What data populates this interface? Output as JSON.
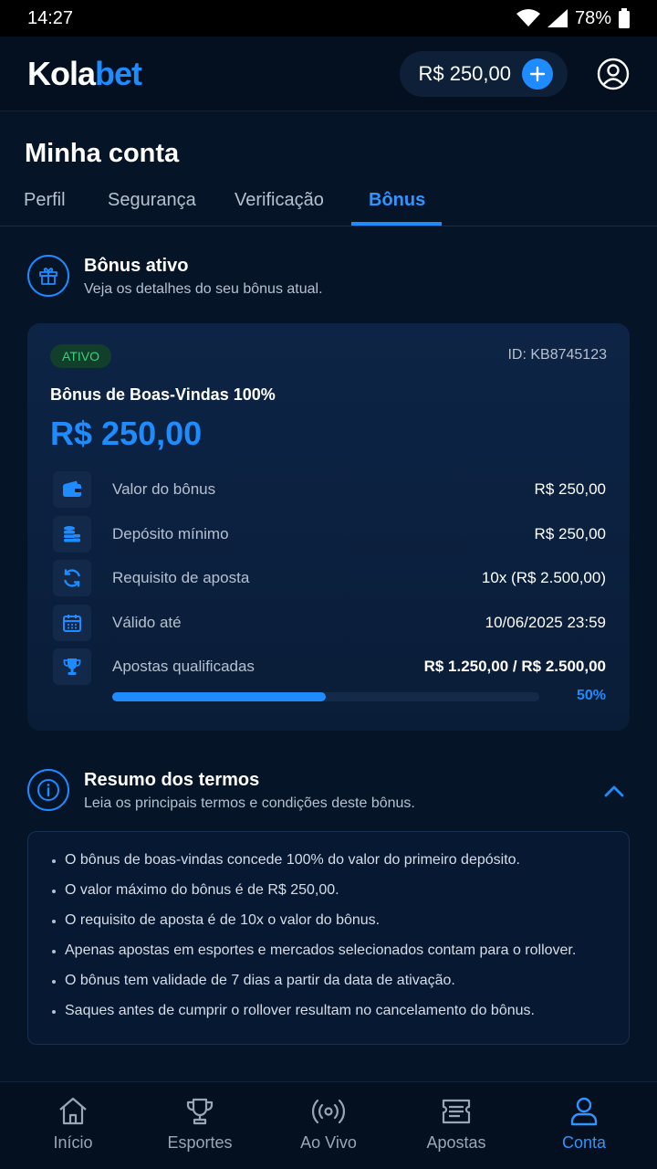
{
  "status": {
    "time": "14:27",
    "battery": "78%"
  },
  "header": {
    "logo_a": "Kola",
    "logo_b": "bet",
    "balance": "R$ 250,00"
  },
  "page": {
    "title": "Minha conta"
  },
  "tabs": [
    {
      "label": "Perfil"
    },
    {
      "label": "Segurança"
    },
    {
      "label": "Verificação"
    },
    {
      "label": "Bônus",
      "active": true
    }
  ],
  "active_bonus": {
    "title": "Bônus ativo",
    "subtitle": "Veja os detalhes do seu bônus atual.",
    "status": "ATIVO",
    "id": "ID: KB8745123",
    "name": "Bônus de Boas-Vindas 100%",
    "amount": "R$ 250,00",
    "rows": [
      {
        "icon": "wallet-icon",
        "label": "Valor do bônus",
        "value": "R$ 250,00"
      },
      {
        "icon": "coins-icon",
        "label": "Depósito mínimo",
        "value": "R$ 250,00"
      },
      {
        "icon": "refresh-icon",
        "label": "Requisito de aposta",
        "value": "10x (R$ 2.500,00)"
      },
      {
        "icon": "calendar-icon",
        "label": "Válido até",
        "value": "10/06/2025 23:59"
      },
      {
        "icon": "trophy-icon",
        "label": "Apostas qualificadas",
        "value": "R$ 1.250,00 / R$ 2.500,00"
      }
    ],
    "progress": 0.5,
    "progress_label": "50%"
  },
  "terms": {
    "title": "Resumo dos termos",
    "subtitle": "Leia os principais termos e condições deste bônus.",
    "items": [
      "O bônus de boas-vindas concede 100% do valor do primeiro depósito.",
      "O valor máximo do bônus é de R$ 250,00.",
      "O requisito de aposta é de 10x o valor do bônus.",
      "Apenas apostas em esportes e mercados selecionados contam para o rollover.",
      "O bônus tem validade de 7 dias a partir da data de ativação.",
      "Saques antes de cumprir o rollover resultam no cancelamento do bônus."
    ]
  },
  "nav": [
    {
      "label": "Início",
      "icon": "home-icon"
    },
    {
      "label": "Esportes",
      "icon": "trophy-icon"
    },
    {
      "label": "Ao Vivo",
      "icon": "live-icon"
    },
    {
      "label": "Apostas",
      "icon": "ticket-icon"
    },
    {
      "label": "Conta",
      "icon": "user-icon",
      "active": true
    }
  ],
  "colors": {
    "accent": "#1e8bff",
    "background": "#061427",
    "success": "#3ad07a"
  }
}
